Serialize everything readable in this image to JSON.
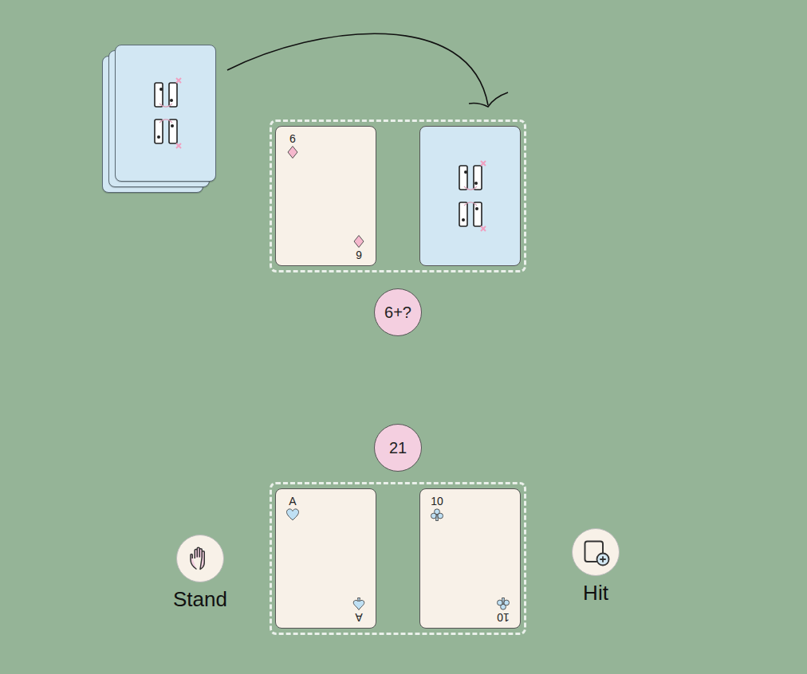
{
  "deck": {
    "stacked": 3
  },
  "dealer": {
    "score": "6+?",
    "cards": [
      {
        "rank": "6",
        "suit": "diamonds",
        "bottom_suit": "diamonds",
        "face_up": true
      },
      {
        "rank": "",
        "suit": "",
        "bottom_suit": "",
        "face_up": false
      }
    ]
  },
  "player": {
    "score": "21",
    "cards": [
      {
        "rank": "A",
        "suit": "hearts",
        "bottom_suit": "spades",
        "face_up": true
      },
      {
        "rank": "10",
        "suit": "clubs",
        "bottom_suit": "clubs",
        "face_up": true
      }
    ]
  },
  "buttons": [
    {
      "label": "Stand",
      "kind": "stand"
    },
    {
      "label": "Hit",
      "kind": "hit"
    }
  ]
}
